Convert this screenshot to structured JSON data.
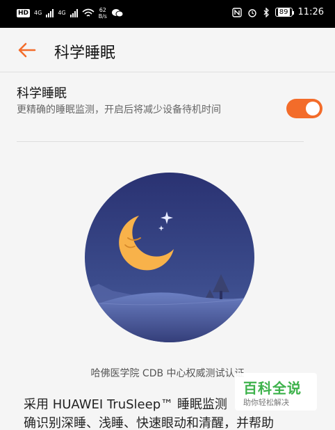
{
  "status_bar": {
    "hd": "HD",
    "network_1": "4G",
    "network_2": "4G",
    "speed_value": "62",
    "speed_unit": "B/s",
    "battery": "89",
    "time": "11:26"
  },
  "header": {
    "title": "科学睡眠"
  },
  "setting": {
    "title": "科学睡眠",
    "description": "更精确的睡眠监测，开启后将减少设备待机时间",
    "enabled": true,
    "accent_color": "#f36c2a"
  },
  "illustration": {
    "subject": "moon-night-landscape"
  },
  "caption": "哈佛医学院 CDB 中心权威测试认证",
  "body": {
    "line1": "采用 HUAWEI TruSleep™ 睡眠监测",
    "line2": "确识别深睡、浅睡、快速眼动和清醒，并帮助"
  },
  "watermark": {
    "main": "百科全说",
    "sub": "助你轻松解决"
  }
}
